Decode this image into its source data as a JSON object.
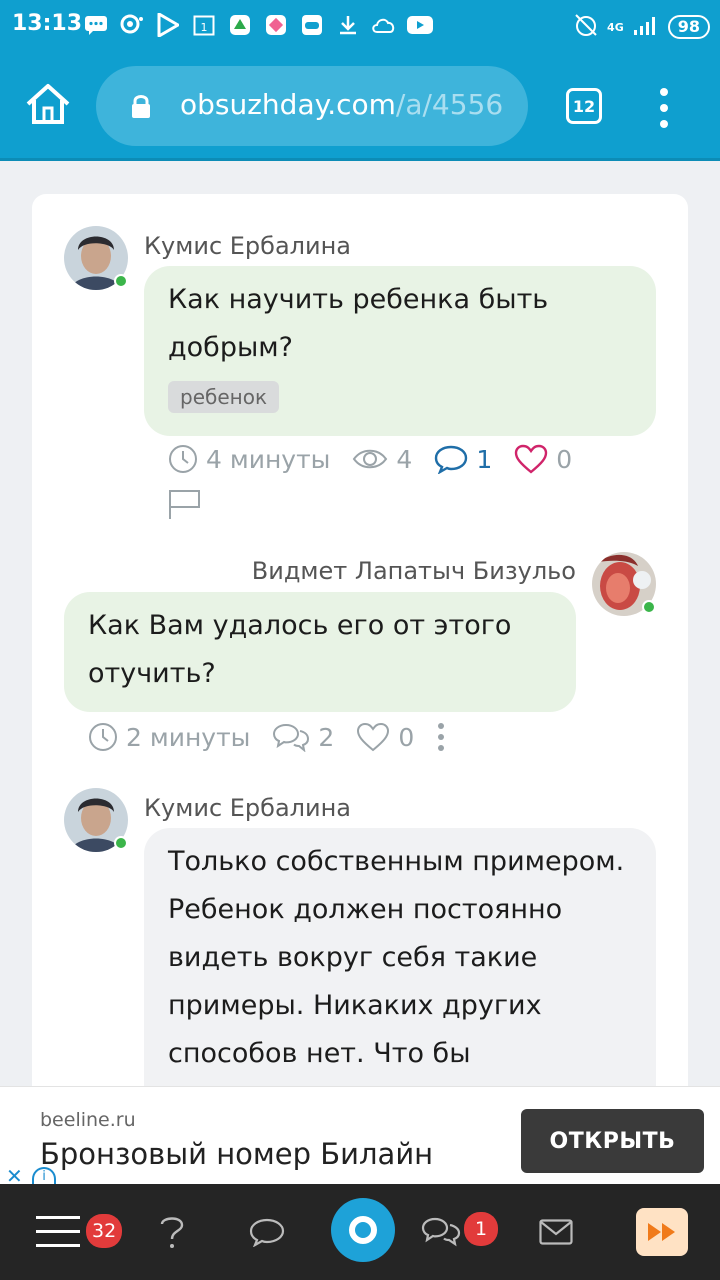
{
  "status_bar": {
    "time": "13:13",
    "network": "4G",
    "battery": "98",
    "icons": [
      "message-icon",
      "assistant-icon",
      "play-store-icon",
      "calendar-icon",
      "app-icon",
      "app-icon",
      "gamepad-icon",
      "download-icon",
      "cloud-icon",
      "youtube-icon"
    ]
  },
  "browser": {
    "url_domain": "obsuzhday.com",
    "url_path": "/a/4556",
    "tab_count": "12"
  },
  "post": {
    "author": "Кумис Ербалина",
    "question": "Как научить ребенка быть добрым?",
    "tag": "ребенок",
    "time": "4 минуты",
    "views": "4",
    "comments": "1",
    "likes": "0"
  },
  "reply1": {
    "author": "Видмет Лапатыч Бизульо",
    "text": "Как Вам удалось его от этого отучить?",
    "time": "2 минуты",
    "comments": "2",
    "likes": "0"
  },
  "reply2": {
    "author": "Кумис Ербалина",
    "text": "Только собственным примером. Ребенок должен постоянно видеть вокруг себя такие примеры. Никаких других способов нет. Что бы"
  },
  "ad": {
    "domain": "beeline.ru",
    "title": "Бронзовый номер Билайн",
    "button": "ОТКРЫТЬ"
  },
  "bottom_nav": {
    "menu_badge": "32",
    "chat_badge": "1"
  },
  "colors": {
    "brand": "#0f9fcf",
    "green_bubble": "#e8f3e5",
    "grey_bubble": "#f1f2f4",
    "comment_blue": "#1f6ea8",
    "like_pink": "#d0246a",
    "badge_red": "#e23b3b"
  }
}
